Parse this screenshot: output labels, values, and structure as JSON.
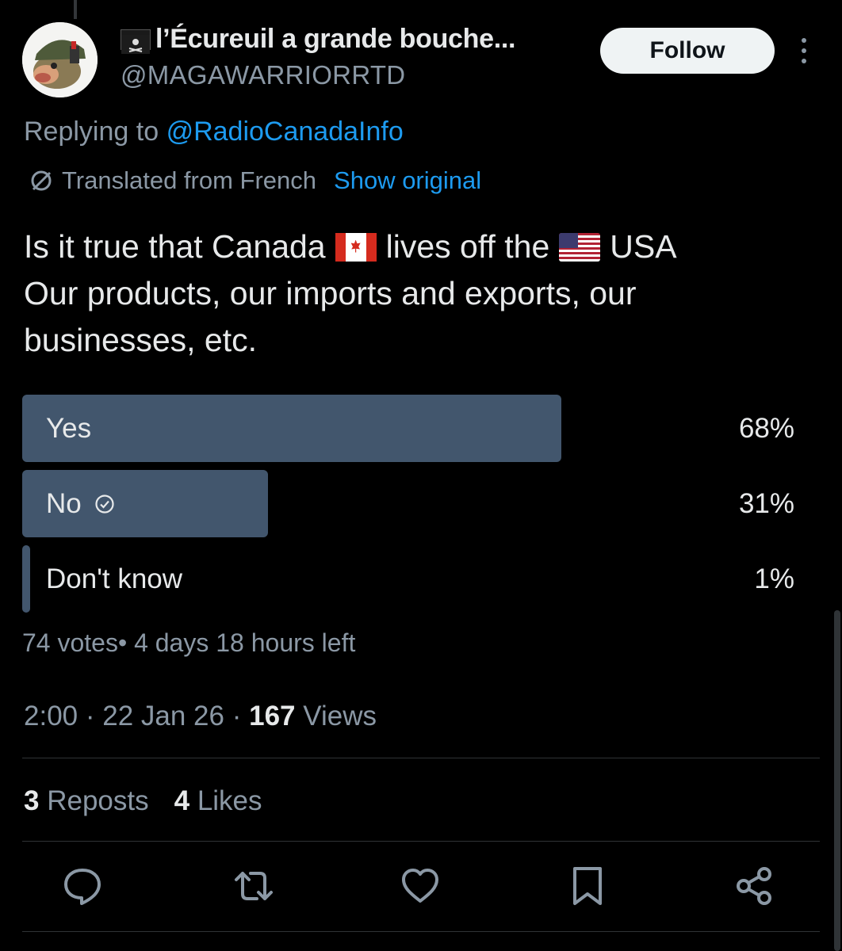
{
  "author": {
    "display_name": "l’Écureuil a grande bouche...",
    "handle": "@MAGAWARRIORRTD",
    "flag_icon": "pirate-flag-icon"
  },
  "header": {
    "follow_label": "Follow",
    "more_icon": "more-icon"
  },
  "reply": {
    "prefix": "Replying to",
    "mention": "@RadioCanadaInfo"
  },
  "translation": {
    "label": "Translated from French",
    "show_original": "Show original"
  },
  "tweet": {
    "line1_part1": "Is it true that Canada",
    "line1_part2": "lives off the",
    "line1_part3": "USA",
    "line2": "Our products, our imports and exports, our",
    "line3": "businesses, etc."
  },
  "poll": {
    "options": [
      {
        "label": "Yes",
        "percent": "68%",
        "fraction": 0.68
      },
      {
        "label": "No",
        "percent": "31%",
        "fraction": 0.31,
        "selected_icon": "check-circle-icon"
      },
      {
        "label": "Don't know",
        "percent": "1%",
        "fraction": 0.01
      }
    ],
    "meta": "74 votes• 4 days 18 hours left"
  },
  "timestamp": {
    "time": "2:00",
    "sep1": "·",
    "date": "22 Jan 26",
    "sep2": "·",
    "views_count": "167",
    "views_label": "Views"
  },
  "stats": {
    "reposts_count": "3",
    "reposts_label": "Reposts",
    "likes_count": "4",
    "likes_label": "Likes"
  },
  "actions": [
    "reply-icon",
    "repost-icon",
    "like-icon",
    "bookmark-icon",
    "share-icon"
  ],
  "colors": {
    "background": "#000000",
    "text": "#e7e9ea",
    "muted": "#8b98a5",
    "link": "#1d9bf0",
    "poll_bar": "#42566d"
  }
}
